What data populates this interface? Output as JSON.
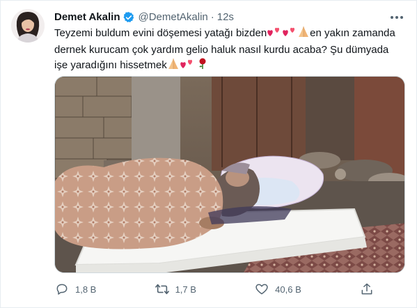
{
  "author": {
    "name": "Demet Akalin",
    "handle": "@DemetAkalin",
    "separator": "·",
    "time": "12s",
    "verified": true
  },
  "tweet": {
    "segments": [
      "Teyzemi buldum evini döşemesi yatağı bizden",
      "en yakın zamanda dernek kurucam çok yardım gelio haluk nasıl kurdu acaba? Şu dümyada işe yaradığını hissetmek"
    ],
    "emoji": [
      "two-hearts",
      "two-hearts",
      "folded-hands",
      "folded-hands",
      "two-hearts",
      "rose"
    ]
  },
  "stats": {
    "replies": "1,8 B",
    "retweets": "1,7 B",
    "likes": "40,6 B"
  },
  "colors": {
    "text": "#0f1419",
    "secondary": "#536471",
    "verified": "#1d9bf0",
    "heart": "#e0245e",
    "border": "#cfd9de"
  },
  "icons": [
    "verified-badge-icon",
    "more-options-icon",
    "reply-icon",
    "retweet-icon",
    "like-icon",
    "share-icon"
  ]
}
